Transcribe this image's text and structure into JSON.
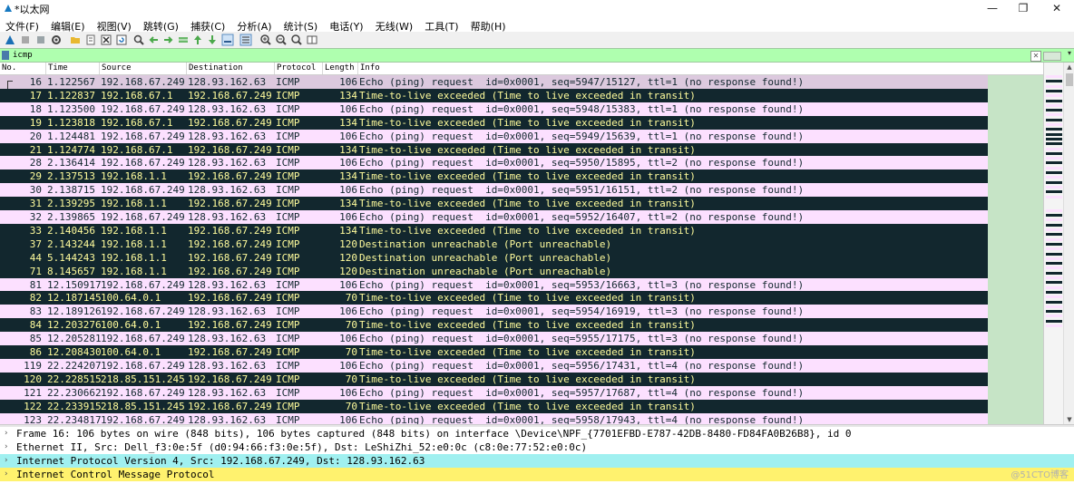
{
  "window": {
    "title": "*以太网",
    "minimize_icon": "—",
    "maximize_icon": "❐",
    "close_icon": "✕"
  },
  "menu": [
    "文件(F)",
    "编辑(E)",
    "视图(V)",
    "跳转(G)",
    "捕获(C)",
    "分析(A)",
    "统计(S)",
    "电话(Y)",
    "无线(W)",
    "工具(T)",
    "帮助(H)"
  ],
  "toolbar_icons": [
    "shark-fin-start-icon",
    "stop-icon",
    "restart-icon",
    "options-gear-icon",
    "open-folder-icon",
    "file-icon",
    "close-file-icon",
    "reload-icon",
    "find-icon",
    "back-arrow-icon",
    "forward-arrow-icon",
    "goto-packet-icon",
    "first-packet-icon",
    "last-packet-icon",
    "autoscroll-icon",
    "colorize-icon",
    "zoom-in-icon",
    "zoom-out-icon",
    "normal-size-icon",
    "resize-columns-icon"
  ],
  "filter": {
    "value": "icmp",
    "clear_label": "✕",
    "dropdown_icon": "▾"
  },
  "columns": [
    "No.",
    "Time",
    "Source",
    "Destination",
    "Protocol",
    "Length",
    "Info"
  ],
  "packets": [
    {
      "no": "16",
      "time": "1.122567",
      "src": "192.168.67.249",
      "dst": "128.93.162.63",
      "proto": "ICMP",
      "len": "106",
      "info": "Echo (ping) request  id=0x0001, seq=5947/15127, ttl=1 (no response found!)",
      "kind": "echo",
      "selected": true
    },
    {
      "no": "17",
      "time": "1.122837",
      "src": "192.168.67.1",
      "dst": "192.168.67.249",
      "proto": "ICMP",
      "len": "134",
      "info": "Time-to-live exceeded (Time to live exceeded in transit)",
      "kind": "ttl"
    },
    {
      "no": "18",
      "time": "1.123500",
      "src": "192.168.67.249",
      "dst": "128.93.162.63",
      "proto": "ICMP",
      "len": "106",
      "info": "Echo (ping) request  id=0x0001, seq=5948/15383, ttl=1 (no response found!)",
      "kind": "echo"
    },
    {
      "no": "19",
      "time": "1.123818",
      "src": "192.168.67.1",
      "dst": "192.168.67.249",
      "proto": "ICMP",
      "len": "134",
      "info": "Time-to-live exceeded (Time to live exceeded in transit)",
      "kind": "ttl"
    },
    {
      "no": "20",
      "time": "1.124481",
      "src": "192.168.67.249",
      "dst": "128.93.162.63",
      "proto": "ICMP",
      "len": "106",
      "info": "Echo (ping) request  id=0x0001, seq=5949/15639, ttl=1 (no response found!)",
      "kind": "echo"
    },
    {
      "no": "21",
      "time": "1.124774",
      "src": "192.168.67.1",
      "dst": "192.168.67.249",
      "proto": "ICMP",
      "len": "134",
      "info": "Time-to-live exceeded (Time to live exceeded in transit)",
      "kind": "ttl"
    },
    {
      "no": "28",
      "time": "2.136414",
      "src": "192.168.67.249",
      "dst": "128.93.162.63",
      "proto": "ICMP",
      "len": "106",
      "info": "Echo (ping) request  id=0x0001, seq=5950/15895, ttl=2 (no response found!)",
      "kind": "echo"
    },
    {
      "no": "29",
      "time": "2.137513",
      "src": "192.168.1.1",
      "dst": "192.168.67.249",
      "proto": "ICMP",
      "len": "134",
      "info": "Time-to-live exceeded (Time to live exceeded in transit)",
      "kind": "ttl"
    },
    {
      "no": "30",
      "time": "2.138715",
      "src": "192.168.67.249",
      "dst": "128.93.162.63",
      "proto": "ICMP",
      "len": "106",
      "info": "Echo (ping) request  id=0x0001, seq=5951/16151, ttl=2 (no response found!)",
      "kind": "echo"
    },
    {
      "no": "31",
      "time": "2.139295",
      "src": "192.168.1.1",
      "dst": "192.168.67.249",
      "proto": "ICMP",
      "len": "134",
      "info": "Time-to-live exceeded (Time to live exceeded in transit)",
      "kind": "ttl"
    },
    {
      "no": "32",
      "time": "2.139865",
      "src": "192.168.67.249",
      "dst": "128.93.162.63",
      "proto": "ICMP",
      "len": "106",
      "info": "Echo (ping) request  id=0x0001, seq=5952/16407, ttl=2 (no response found!)",
      "kind": "echo"
    },
    {
      "no": "33",
      "time": "2.140456",
      "src": "192.168.1.1",
      "dst": "192.168.67.249",
      "proto": "ICMP",
      "len": "134",
      "info": "Time-to-live exceeded (Time to live exceeded in transit)",
      "kind": "ttl"
    },
    {
      "no": "37",
      "time": "2.143244",
      "src": "192.168.1.1",
      "dst": "192.168.67.249",
      "proto": "ICMP",
      "len": "120",
      "info": "Destination unreachable (Port unreachable)",
      "kind": "ttl"
    },
    {
      "no": "44",
      "time": "5.144243",
      "src": "192.168.1.1",
      "dst": "192.168.67.249",
      "proto": "ICMP",
      "len": "120",
      "info": "Destination unreachable (Port unreachable)",
      "kind": "ttl"
    },
    {
      "no": "71",
      "time": "8.145657",
      "src": "192.168.1.1",
      "dst": "192.168.67.249",
      "proto": "ICMP",
      "len": "120",
      "info": "Destination unreachable (Port unreachable)",
      "kind": "ttl"
    },
    {
      "no": "81",
      "time": "12.150917",
      "src": "192.168.67.249",
      "dst": "128.93.162.63",
      "proto": "ICMP",
      "len": "106",
      "info": "Echo (ping) request  id=0x0001, seq=5953/16663, ttl=3 (no response found!)",
      "kind": "echo"
    },
    {
      "no": "82",
      "time": "12.187145",
      "src": "100.64.0.1",
      "dst": "192.168.67.249",
      "proto": "ICMP",
      "len": "70",
      "info": "Time-to-live exceeded (Time to live exceeded in transit)",
      "kind": "ttl"
    },
    {
      "no": "83",
      "time": "12.189126",
      "src": "192.168.67.249",
      "dst": "128.93.162.63",
      "proto": "ICMP",
      "len": "106",
      "info": "Echo (ping) request  id=0x0001, seq=5954/16919, ttl=3 (no response found!)",
      "kind": "echo"
    },
    {
      "no": "84",
      "time": "12.203276",
      "src": "100.64.0.1",
      "dst": "192.168.67.249",
      "proto": "ICMP",
      "len": "70",
      "info": "Time-to-live exceeded (Time to live exceeded in transit)",
      "kind": "ttl"
    },
    {
      "no": "85",
      "time": "12.205281",
      "src": "192.168.67.249",
      "dst": "128.93.162.63",
      "proto": "ICMP",
      "len": "106",
      "info": "Echo (ping) request  id=0x0001, seq=5955/17175, ttl=3 (no response found!)",
      "kind": "echo"
    },
    {
      "no": "86",
      "time": "12.208430",
      "src": "100.64.0.1",
      "dst": "192.168.67.249",
      "proto": "ICMP",
      "len": "70",
      "info": "Time-to-live exceeded (Time to live exceeded in transit)",
      "kind": "ttl"
    },
    {
      "no": "119",
      "time": "22.224207",
      "src": "192.168.67.249",
      "dst": "128.93.162.63",
      "proto": "ICMP",
      "len": "106",
      "info": "Echo (ping) request  id=0x0001, seq=5956/17431, ttl=4 (no response found!)",
      "kind": "echo"
    },
    {
      "no": "120",
      "time": "22.228515",
      "src": "218.85.151.245",
      "dst": "192.168.67.249",
      "proto": "ICMP",
      "len": "70",
      "info": "Time-to-live exceeded (Time to live exceeded in transit)",
      "kind": "ttl"
    },
    {
      "no": "121",
      "time": "22.230662",
      "src": "192.168.67.249",
      "dst": "128.93.162.63",
      "proto": "ICMP",
      "len": "106",
      "info": "Echo (ping) request  id=0x0001, seq=5957/17687, ttl=4 (no response found!)",
      "kind": "echo"
    },
    {
      "no": "122",
      "time": "22.233915",
      "src": "218.85.151.245",
      "dst": "192.168.67.249",
      "proto": "ICMP",
      "len": "70",
      "info": "Time-to-live exceeded (Time to live exceeded in transit)",
      "kind": "ttl"
    },
    {
      "no": "123",
      "time": "22.234817",
      "src": "192.168.67.249",
      "dst": "128.93.162.63",
      "proto": "ICMP",
      "len": "106",
      "info": "Echo (ping) request  id=0x0001, seq=5958/17943, ttl=4 (no response found!)",
      "kind": "echo"
    }
  ],
  "details": [
    {
      "text": "Frame 16: 106 bytes on wire (848 bits), 106 bytes captured (848 bits) on interface \\Device\\NPF_{7701EFBD-E787-42DB-8480-FD84FA0B26B8}, id 0",
      "kind": "frame"
    },
    {
      "text": "Ethernet II, Src: Dell_f3:0e:5f (d0:94:66:f3:0e:5f), Dst: LeShiZhi_52:e0:0c (c8:0e:77:52:e0:0c)",
      "kind": "eth"
    },
    {
      "text": "Internet Protocol Version 4, Src: 192.168.67.249, Dst: 128.93.162.63",
      "kind": "ip"
    },
    {
      "text": "Internet Control Message Protocol",
      "kind": "icmp"
    }
  ],
  "detail_arrow": "›",
  "watermark": "@51CTO博客",
  "colors": {
    "echo_bg": "#fce0ff",
    "echo_fg": "#12272e",
    "ttl_bg": "#12272e",
    "ttl_fg": "#fffc9c",
    "selected_bg": "#dcc9de",
    "filter_bg": "#afffaf",
    "ip_detail_bg": "#a0f0f0",
    "icmp_detail_bg": "#fff26e"
  }
}
